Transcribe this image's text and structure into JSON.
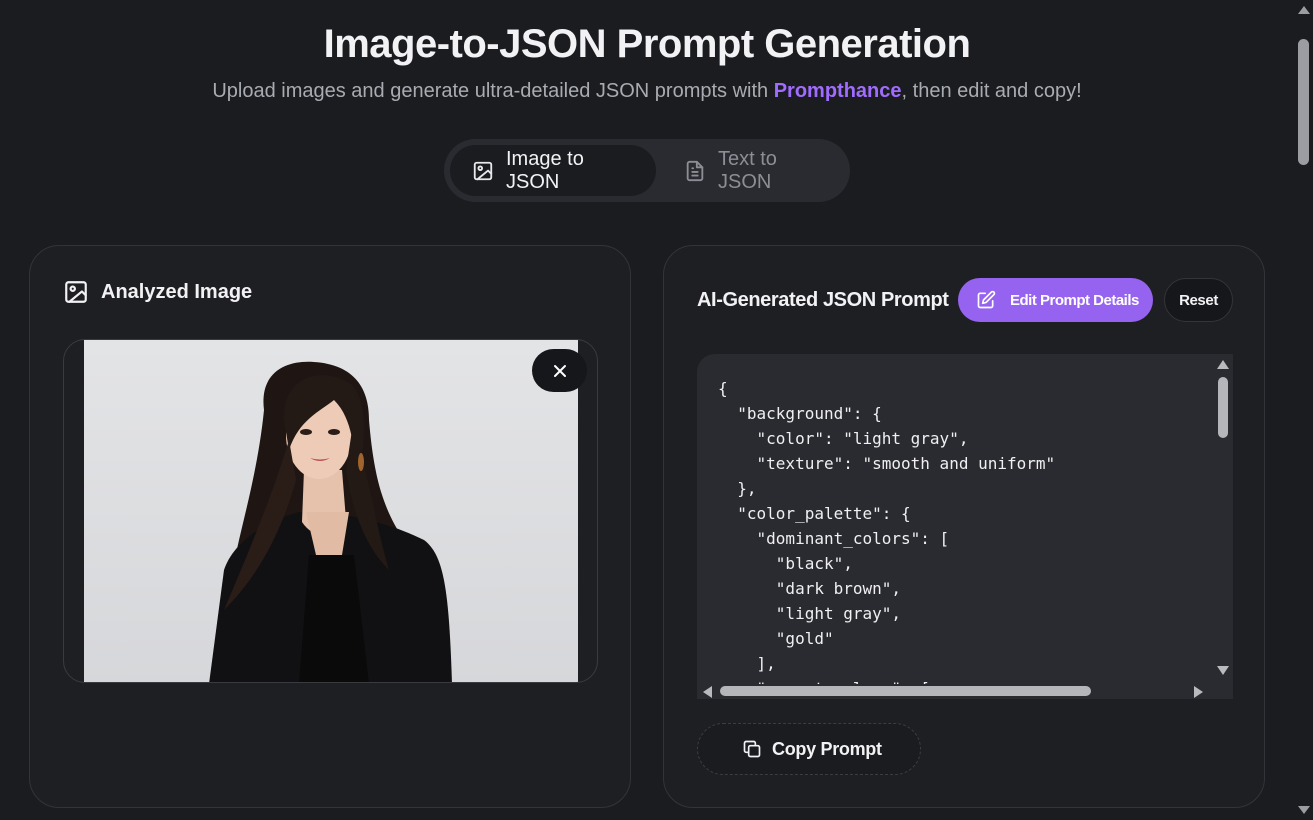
{
  "header": {
    "title": "Image-to-JSON Prompt Generation",
    "subtitle_before": "Upload images and generate ultra-detailed JSON prompts with ",
    "subtitle_brand": "Prompthance",
    "subtitle_after": ", then edit and copy!"
  },
  "mode_tabs": [
    {
      "label": "Image to JSON",
      "icon": "image-icon",
      "active": true
    },
    {
      "label": "Text to JSON",
      "icon": "document-icon",
      "active": false
    }
  ],
  "left_panel": {
    "title": "Analyzed Image",
    "icon": "image-icon",
    "close_icon": "close-icon"
  },
  "right_panel": {
    "title": "AI-Generated JSON Prompt",
    "edit_label": "Edit Prompt Details",
    "reset_label": "Reset",
    "copy_label": "Copy Prompt",
    "json_text": "{\n  \"background\": {\n    \"color\": \"light gray\",\n    \"texture\": \"smooth and uniform\"\n  },\n  \"color_palette\": {\n    \"dominant_colors\": [\n      \"black\",\n      \"dark brown\",\n      \"light gray\",\n      \"gold\"\n    ],\n    \"accent_colors\": ["
  },
  "colors": {
    "background": "#1b1c1f",
    "accent": "#9563f0",
    "brand_text": "#a06cff"
  }
}
